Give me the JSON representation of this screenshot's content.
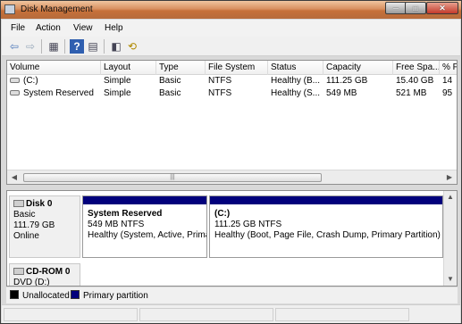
{
  "window": {
    "title": "Disk Management",
    "caption_min": "─",
    "caption_max": "□",
    "caption_close": "✕"
  },
  "menu": [
    "File",
    "Action",
    "View",
    "Help"
  ],
  "toolbar": {
    "icons": [
      "back-arrow-icon",
      "forward-arrow-icon",
      "console-tree-icon",
      "help-icon",
      "properties-icon",
      "settings-icon",
      "rescan-icon"
    ],
    "glyphs": {
      "back": "⇦",
      "forward": "⇨",
      "console": "▦",
      "help": "?",
      "props": "▤",
      "settings": "◧",
      "rescan": "⟲"
    }
  },
  "volume_list": {
    "columns": [
      "Volume",
      "Layout",
      "Type",
      "File System",
      "Status",
      "Capacity",
      "Free Spa...",
      "% F"
    ],
    "rows": [
      {
        "volume": "(C:)",
        "layout": "Simple",
        "type": "Basic",
        "fs": "NTFS",
        "status": "Healthy (B...",
        "capacity": "111.25 GB",
        "free": "15.40 GB",
        "pct": "14"
      },
      {
        "volume": "System Reserved",
        "layout": "Simple",
        "type": "Basic",
        "fs": "NTFS",
        "status": "Healthy (S...",
        "capacity": "549 MB",
        "free": "521 MB",
        "pct": "95"
      }
    ],
    "scroll_left": "◀",
    "scroll_right": "▶",
    "thumb_grip": "|||"
  },
  "disks": [
    {
      "name": "Disk 0",
      "type": "Basic",
      "size": "111.79 GB",
      "status": "Online",
      "partitions": [
        {
          "name": "System Reserved",
          "size_fs": "549 MB NTFS",
          "status": "Healthy (System, Active, Primary Partition)"
        },
        {
          "name": "(C:)",
          "size_fs": "111.25 GB NTFS",
          "status": "Healthy (Boot, Page File, Crash Dump, Primary Partition)"
        }
      ]
    },
    {
      "name": "CD-ROM 0",
      "type": "DVD (D:)"
    }
  ],
  "disk_scroll_up": "▲",
  "disk_scroll_down": "▼",
  "legend": [
    {
      "label": "Unallocated",
      "color": "#000000"
    },
    {
      "label": "Primary partition",
      "color": "#02017c"
    }
  ]
}
